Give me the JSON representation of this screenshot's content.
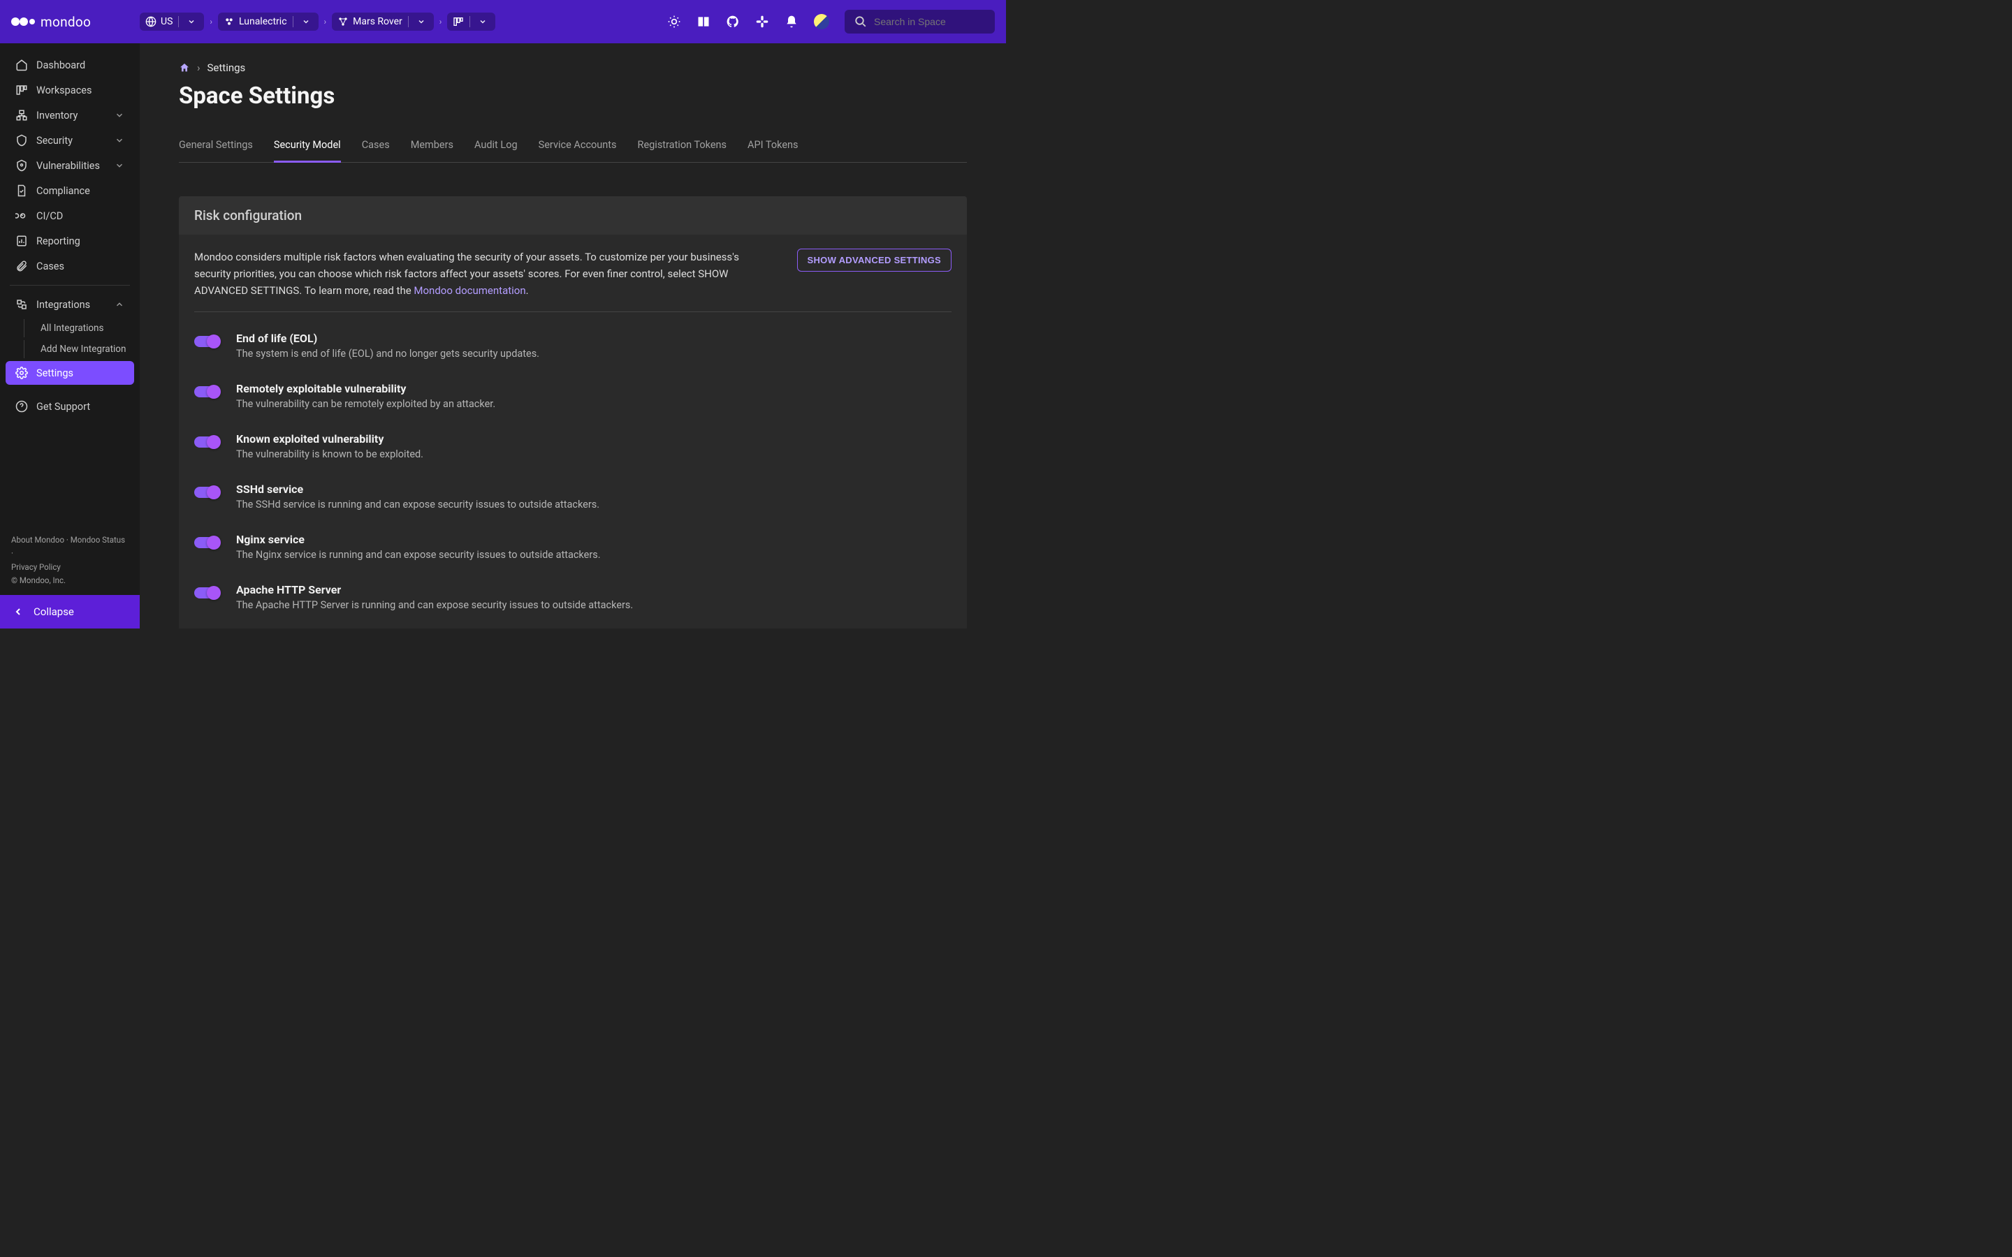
{
  "brand": {
    "name": "mondoo"
  },
  "topnav": {
    "region_label": "US",
    "org_label": "Lunalectric",
    "space_label": "Mars Rover",
    "search_placeholder": "Search in Space"
  },
  "sidebar": {
    "items": [
      {
        "label": "Dashboard"
      },
      {
        "label": "Workspaces"
      },
      {
        "label": "Inventory"
      },
      {
        "label": "Security"
      },
      {
        "label": "Vulnerabilities"
      },
      {
        "label": "Compliance"
      },
      {
        "label": "CI/CD"
      },
      {
        "label": "Reporting"
      },
      {
        "label": "Cases"
      },
      {
        "label": "Integrations"
      },
      {
        "label": "Settings"
      },
      {
        "label": "Get Support"
      }
    ],
    "integration_children": [
      {
        "label": "All Integrations"
      },
      {
        "label": "Add New Integration"
      }
    ],
    "footer": {
      "about": "About Mondoo",
      "status": "Mondoo Status",
      "privacy": "Privacy Policy",
      "copyright": "© Mondoo, Inc."
    },
    "collapse_label": "Collapse"
  },
  "breadcrumb": {
    "current": "Settings"
  },
  "page": {
    "title": "Space Settings"
  },
  "tabs": [
    "General Settings",
    "Security Model",
    "Cases",
    "Members",
    "Audit Log",
    "Service Accounts",
    "Registration Tokens",
    "API Tokens"
  ],
  "card": {
    "header": "Risk configuration",
    "intro_a": "Mondoo considers multiple risk factors when evaluating the security of your assets. To customize per your business's security priorities, you can choose which risk factors affect your assets' scores. For even finer control, select SHOW ADVANCED SETTINGS. To learn more, read the ",
    "intro_link": "Mondoo documentation",
    "intro_b": ".",
    "advanced_button": "SHOW ADVANCED SETTINGS",
    "risks": [
      {
        "title": "End of life (EOL)",
        "desc": "The system is end of life (EOL) and no longer gets security updates."
      },
      {
        "title": "Remotely exploitable vulnerability",
        "desc": "The vulnerability can be remotely exploited by an attacker."
      },
      {
        "title": "Known exploited vulnerability",
        "desc": "The vulnerability is known to be exploited."
      },
      {
        "title": "SSHd service",
        "desc": "The SSHd service is running and can expose security issues to outside attackers."
      },
      {
        "title": "Nginx service",
        "desc": "The Nginx service is running and can expose security issues to outside attackers."
      },
      {
        "title": "Apache HTTP Server",
        "desc": "The Apache HTTP Server is running and can expose security issues to outside attackers."
      }
    ]
  }
}
